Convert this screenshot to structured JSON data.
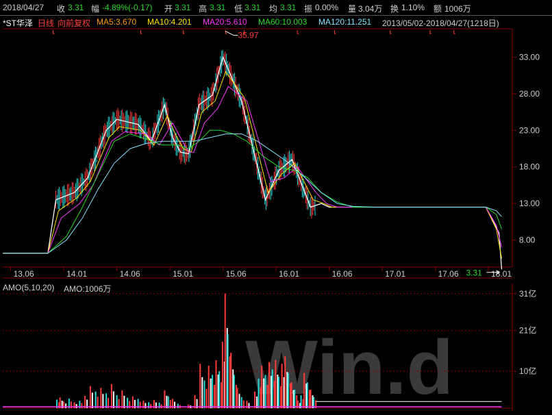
{
  "header": {
    "date": "2018/04/27",
    "close_label": "收",
    "close_value": "3.31",
    "change_label": "幅",
    "change_value": "-4.89%(-0.17)",
    "open_label": "开",
    "open_value": "3.31",
    "high_label": "高",
    "high_value": "3.31",
    "low_label": "低",
    "low_value": "3.31",
    "avg_label": "均",
    "avg_value": "3.31",
    "amp_label": "振",
    "amp_value": "0.00%",
    "vol_label": "量",
    "vol_value": "3.04万",
    "turn_label": "换",
    "turn_value": "1.10%",
    "amount_label": "额",
    "amount_value": "1006万"
  },
  "indicators": {
    "name": "*ST华泽",
    "period": "日线",
    "adjust": "向前复权",
    "ma5": "MA5:3.670",
    "ma10": "MA10:4.201",
    "ma20": "MA20:5.610",
    "ma60": "MA60:10.003",
    "ma120": "MA120:11.251",
    "range": "2013/05/02-2018/04/27(1218日)"
  },
  "amo_header": {
    "label": "AMO(5,10,20)",
    "value": "AMO:1006万"
  },
  "watermark": "Win.d",
  "colors": {
    "background": "#000000",
    "up": "#ff3b3b",
    "down": "#26d9d9",
    "ma5": "#ffffff",
    "ma10": "#ffe400",
    "ma20": "#ff33ff",
    "ma60": "#26d926",
    "ma120": "#7fe5ff",
    "grid": "#8b0000"
  },
  "chart_data": [
    {
      "type": "line",
      "title": "",
      "x_tick_labels": [
        "13.06",
        "14.01",
        "14.06",
        "15.01",
        "15.06",
        "16.01",
        "16.06",
        "17.01",
        "17.06",
        "18.01"
      ],
      "y_tick_labels": [
        "33.00",
        "28.00",
        "23.00",
        "18.00",
        "13.00",
        "8.00"
      ],
      "ylim": [
        4.5,
        36.5
      ],
      "annotations": {
        "high_label": "35.97",
        "last_label": "3.31"
      },
      "series": [
        {
          "name": "MA5",
          "x": [
            0,
            0.5,
            0.85,
            1.0,
            1.35,
            1.6,
            1.95,
            2.15,
            2.55,
            2.8,
            3.05,
            3.2,
            3.35,
            3.5,
            3.7,
            3.95,
            4.15,
            4.5,
            4.95,
            5.2,
            5.45,
            5.8,
            6.0,
            6.15,
            6.4,
            6.5,
            6.65,
            7.0,
            7.3,
            7.5,
            7.9,
            8.2,
            9.1,
            9.35,
            9.4
          ],
          "values": [
            6.2,
            6.2,
            6.2,
            13.5,
            14.5,
            16.5,
            23.0,
            24.5,
            23.8,
            21.5,
            26.5,
            22.0,
            20.0,
            19.8,
            26.5,
            27.8,
            33.0,
            27.0,
            13.5,
            17.5,
            19.0,
            12.5,
            13.0,
            12.5,
            12.5,
            12.5,
            12.5,
            12.5,
            12.5,
            12.5,
            12.5,
            12.5,
            12.5,
            9.0,
            4.0
          ]
        },
        {
          "name": "MA10",
          "x": [
            0,
            0.5,
            0.85,
            1.05,
            1.4,
            1.65,
            2.0,
            2.2,
            2.6,
            2.85,
            3.1,
            3.25,
            3.4,
            3.55,
            3.75,
            4.0,
            4.2,
            4.55,
            5.0,
            5.25,
            5.5,
            5.85,
            6.05,
            6.2,
            6.5,
            7.0,
            7.5,
            8.0,
            8.5,
            9.1,
            9.3,
            9.4
          ],
          "values": [
            6.2,
            6.2,
            6.2,
            12.0,
            13.8,
            16.0,
            22.0,
            23.5,
            23.0,
            21.0,
            25.0,
            22.5,
            20.5,
            20.0,
            25.5,
            27.0,
            31.0,
            27.5,
            14.5,
            17.0,
            18.5,
            13.5,
            13.0,
            12.5,
            12.5,
            12.5,
            12.5,
            12.5,
            12.5,
            12.5,
            9.5,
            5.5
          ]
        },
        {
          "name": "MA20",
          "x": [
            0,
            0.5,
            0.85,
            1.1,
            1.45,
            1.7,
            2.05,
            2.3,
            2.7,
            2.95,
            3.2,
            3.35,
            3.5,
            3.6,
            3.8,
            4.05,
            4.25,
            4.6,
            5.05,
            5.3,
            5.55,
            5.9,
            6.1,
            6.3,
            6.6,
            7.0,
            7.5,
            8.0,
            8.5,
            9.1,
            9.3,
            9.4
          ],
          "values": [
            6.2,
            6.2,
            6.2,
            11.0,
            13.0,
            15.5,
            21.5,
            22.8,
            22.5,
            21.0,
            24.0,
            22.0,
            20.0,
            20.0,
            24.0,
            26.0,
            29.0,
            27.0,
            16.0,
            16.5,
            18.0,
            14.5,
            13.0,
            12.5,
            12.5,
            12.5,
            12.5,
            12.5,
            12.5,
            12.5,
            10.0,
            7.0
          ]
        },
        {
          "name": "MA60",
          "x": [
            0,
            0.5,
            0.85,
            1.2,
            1.5,
            1.8,
            2.1,
            2.4,
            2.7,
            3.0,
            3.3,
            3.5,
            3.7,
            3.9,
            4.1,
            4.35,
            4.6,
            4.9,
            5.2,
            5.5,
            5.75,
            6.0,
            6.3,
            6.6,
            7.0,
            7.5,
            8.0,
            8.5,
            9.1,
            9.3,
            9.4
          ],
          "values": [
            6.2,
            6.2,
            6.2,
            8.5,
            12.5,
            17.0,
            21.5,
            22.5,
            21.8,
            21.0,
            21.0,
            20.5,
            21.5,
            23.0,
            23.0,
            22.5,
            21.5,
            19.5,
            18.0,
            17.5,
            16.5,
            14.5,
            13.2,
            12.5,
            12.5,
            12.5,
            12.5,
            12.5,
            12.5,
            11.5,
            9.5
          ]
        },
        {
          "name": "MA120",
          "x": [
            0,
            0.5,
            0.85,
            1.2,
            1.5,
            1.8,
            2.1,
            2.4,
            2.7,
            3.0,
            3.3,
            3.6,
            3.9,
            4.2,
            4.5,
            4.8,
            5.1,
            5.4,
            5.7,
            6.0,
            6.3,
            6.6,
            7.0,
            7.5,
            8.0,
            8.5,
            9.1,
            9.3,
            9.4
          ],
          "values": [
            6.2,
            6.2,
            6.2,
            8.0,
            11.0,
            15.0,
            18.5,
            20.5,
            21.2,
            21.5,
            21.5,
            21.5,
            22.0,
            22.5,
            22.5,
            21.5,
            20.0,
            18.5,
            16.5,
            14.5,
            13.0,
            12.6,
            12.5,
            12.5,
            12.5,
            12.5,
            12.5,
            12.0,
            11.2
          ]
        }
      ]
    },
    {
      "type": "bar",
      "title": "",
      "y_tick_labels": [
        "31亿",
        "21亿",
        "10亿"
      ],
      "ylim": [
        0,
        33
      ],
      "series_note": "AMO volume bars with 5/10/20 averages",
      "bars": [
        {
          "x": 1.02,
          "v": 2.3,
          "c": "down"
        },
        {
          "x": 1.08,
          "v": 2.9,
          "c": "up"
        },
        {
          "x": 1.15,
          "v": 1.8,
          "c": "up"
        },
        {
          "x": 1.25,
          "v": 2.6,
          "c": "down"
        },
        {
          "x": 1.35,
          "v": 1.6,
          "c": "up"
        },
        {
          "x": 1.45,
          "v": 2.0,
          "c": "down"
        },
        {
          "x": 1.55,
          "v": 3.3,
          "c": "up"
        },
        {
          "x": 1.65,
          "v": 6.0,
          "c": "up"
        },
        {
          "x": 1.75,
          "v": 4.5,
          "c": "down"
        },
        {
          "x": 1.85,
          "v": 5.5,
          "c": "up"
        },
        {
          "x": 1.95,
          "v": 4.0,
          "c": "down"
        },
        {
          "x": 2.05,
          "v": 6.5,
          "c": "up"
        },
        {
          "x": 2.15,
          "v": 3.5,
          "c": "down"
        },
        {
          "x": 2.25,
          "v": 4.8,
          "c": "up"
        },
        {
          "x": 2.35,
          "v": 2.8,
          "c": "down"
        },
        {
          "x": 2.45,
          "v": 3.2,
          "c": "up"
        },
        {
          "x": 2.55,
          "v": 2.5,
          "c": "down"
        },
        {
          "x": 2.65,
          "v": 2.0,
          "c": "up"
        },
        {
          "x": 2.75,
          "v": 1.6,
          "c": "down"
        },
        {
          "x": 2.85,
          "v": 2.2,
          "c": "up"
        },
        {
          "x": 2.95,
          "v": 1.5,
          "c": "down"
        },
        {
          "x": 3.05,
          "v": 4.8,
          "c": "up"
        },
        {
          "x": 3.12,
          "v": 3.2,
          "c": "down"
        },
        {
          "x": 3.2,
          "v": 2.5,
          "c": "up"
        },
        {
          "x": 3.3,
          "v": 1.2,
          "c": "down"
        },
        {
          "x": 3.5,
          "v": 1.0,
          "c": "up"
        },
        {
          "x": 3.62,
          "v": 3.5,
          "c": "up"
        },
        {
          "x": 3.72,
          "v": 12.0,
          "c": "up"
        },
        {
          "x": 3.8,
          "v": 7.5,
          "c": "down"
        },
        {
          "x": 3.88,
          "v": 11.5,
          "c": "up"
        },
        {
          "x": 3.95,
          "v": 9.0,
          "c": "down"
        },
        {
          "x": 4.02,
          "v": 13.0,
          "c": "up"
        },
        {
          "x": 4.08,
          "v": 10.0,
          "c": "down"
        },
        {
          "x": 4.14,
          "v": 18.0,
          "c": "up"
        },
        {
          "x": 4.19,
          "v": 31.0,
          "c": "up"
        },
        {
          "x": 4.24,
          "v": 20.0,
          "c": "down"
        },
        {
          "x": 4.3,
          "v": 15.0,
          "c": "up"
        },
        {
          "x": 4.36,
          "v": 9.0,
          "c": "down"
        },
        {
          "x": 4.42,
          "v": 5.5,
          "c": "up"
        },
        {
          "x": 4.5,
          "v": 3.0,
          "c": "down"
        },
        {
          "x": 4.6,
          "v": 2.0,
          "c": "up"
        },
        {
          "x": 4.75,
          "v": 4.5,
          "c": "up"
        },
        {
          "x": 4.82,
          "v": 8.0,
          "c": "down"
        },
        {
          "x": 4.88,
          "v": 11.5,
          "c": "up"
        },
        {
          "x": 4.95,
          "v": 9.0,
          "c": "down"
        },
        {
          "x": 5.02,
          "v": 12.5,
          "c": "up"
        },
        {
          "x": 5.08,
          "v": 10.5,
          "c": "down"
        },
        {
          "x": 5.14,
          "v": 13.0,
          "c": "up"
        },
        {
          "x": 5.2,
          "v": 8.5,
          "c": "down"
        },
        {
          "x": 5.26,
          "v": 12.0,
          "c": "up"
        },
        {
          "x": 5.32,
          "v": 14.0,
          "c": "up"
        },
        {
          "x": 5.38,
          "v": 9.5,
          "c": "down"
        },
        {
          "x": 5.44,
          "v": 7.0,
          "c": "up"
        },
        {
          "x": 5.5,
          "v": 5.0,
          "c": "down"
        },
        {
          "x": 5.56,
          "v": 2.0,
          "c": "up"
        },
        {
          "x": 5.62,
          "v": 3.5,
          "c": "down"
        },
        {
          "x": 5.68,
          "v": 9.5,
          "c": "up"
        },
        {
          "x": 5.74,
          "v": 7.0,
          "c": "down"
        },
        {
          "x": 5.8,
          "v": 5.0,
          "c": "up"
        },
        {
          "x": 5.86,
          "v": 3.0,
          "c": "down"
        }
      ],
      "avg_line": {
        "name": "AMO20",
        "x": [
          5.9,
          9.4
        ],
        "values": [
          1.8,
          1.8
        ]
      }
    }
  ]
}
